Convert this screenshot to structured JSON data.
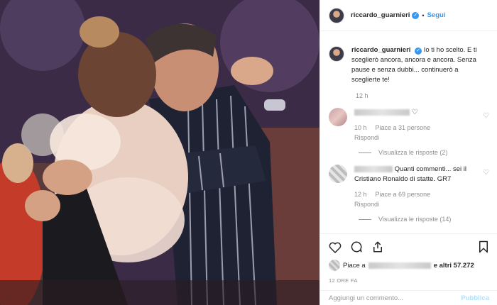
{
  "post": {
    "username": "riccardo_guarnieri",
    "follow_label": "Segui",
    "dot": "•",
    "caption": "Io ti ho scelto. E ti sceglierò ancora, ancora e ancora. Senza pause e senza dubbi... continuerò a sceglierte te!",
    "caption_time": "12 h"
  },
  "comments": [
    {
      "author_hidden": true,
      "text": "",
      "time": "10 h",
      "likes": "Piace a 31 persone",
      "reply": "Rispondi",
      "view_replies": "Visualizza le risposte (2)"
    },
    {
      "author_hidden": true,
      "text": "Quanti commenti... sei il Cristiano Ronaldo di statte. GR7",
      "time": "12 h",
      "likes": "Piace a 69 persone",
      "reply": "Rispondi",
      "view_replies": "Visualizza le risposte (14)"
    }
  ],
  "likes_bar": {
    "prefix": "Piace a",
    "suffix": "e altri 57.272",
    "time_ago": "12 ORE FA"
  },
  "add_comment": {
    "placeholder": "Aggiungi un commento...",
    "publish_label": "Pubblica"
  },
  "colors": {
    "accent": "#3897f0",
    "muted": "#8e8e8e",
    "publish_disabled": "#b2dffc"
  },
  "icons": [
    "heart-icon",
    "comment-icon",
    "share-icon",
    "bookmark-icon",
    "verified-badge-icon"
  ]
}
